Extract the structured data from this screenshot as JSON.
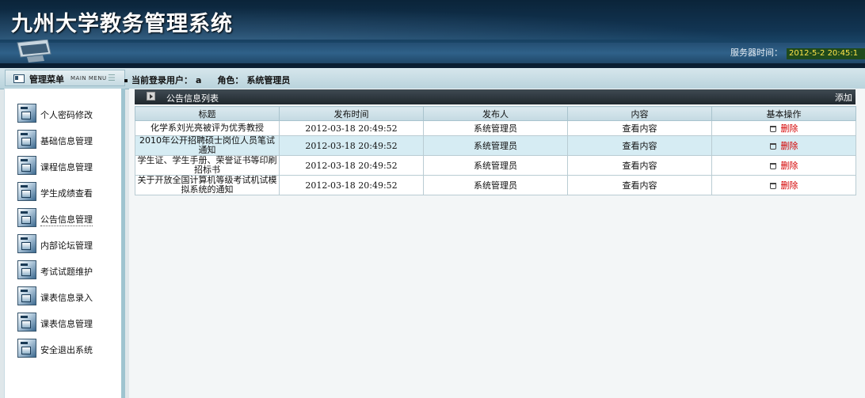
{
  "header": {
    "system_title": "九州大学教务管理系统",
    "server_time_label": "服务器时间：",
    "server_time_value": "2012-5-2 20:45:1"
  },
  "menu": {
    "title": "管理菜单",
    "subtitle": "MAIN MENU"
  },
  "user": {
    "login_label": "当前登录用户：",
    "login_value": "a",
    "role_label": "角色：",
    "role_value": "系统管理员"
  },
  "sidebar": {
    "items": [
      {
        "label": "个人密码修改"
      },
      {
        "label": "基础信息管理"
      },
      {
        "label": "课程信息管理"
      },
      {
        "label": "学生成绩查看"
      },
      {
        "label": "公告信息管理"
      },
      {
        "label": "内部论坛管理"
      },
      {
        "label": "考试试题维护"
      },
      {
        "label": "课表信息录入"
      },
      {
        "label": "课表信息管理"
      },
      {
        "label": "安全退出系统"
      }
    ],
    "active_index": 4
  },
  "list": {
    "title": "公告信息列表",
    "add_label": "添加",
    "columns": [
      "标题",
      "发布时间",
      "发布人",
      "内容",
      "基本操作"
    ],
    "rows": [
      {
        "title": "化学系刘光亮被评为优秀教授",
        "time": "2012-03-18 20:49:52",
        "publisher": "系统管理员",
        "content": "查看内容",
        "action": "删除"
      },
      {
        "title": "2010年公开招聘硕士岗位人员笔试通知",
        "time": "2012-03-18 20:49:52",
        "publisher": "系统管理员",
        "content": "查看内容",
        "action": "删除"
      },
      {
        "title": "学生证、学生手册、荣誉证书等印刷招标书",
        "time": "2012-03-18 20:49:52",
        "publisher": "系统管理员",
        "content": "查看内容",
        "action": "删除"
      },
      {
        "title": "关于开放全国计算机等级考试机试模拟系统的通知",
        "time": "2012-03-18 20:49:52",
        "publisher": "系统管理员",
        "content": "查看内容",
        "action": "删除"
      }
    ]
  },
  "colors": {
    "header_dark": "#0b2439",
    "header_band": "#2f6189",
    "server_time_text": "#ffe54a",
    "delete_link": "#d40000",
    "highlight_row": "#d6ecf3"
  }
}
